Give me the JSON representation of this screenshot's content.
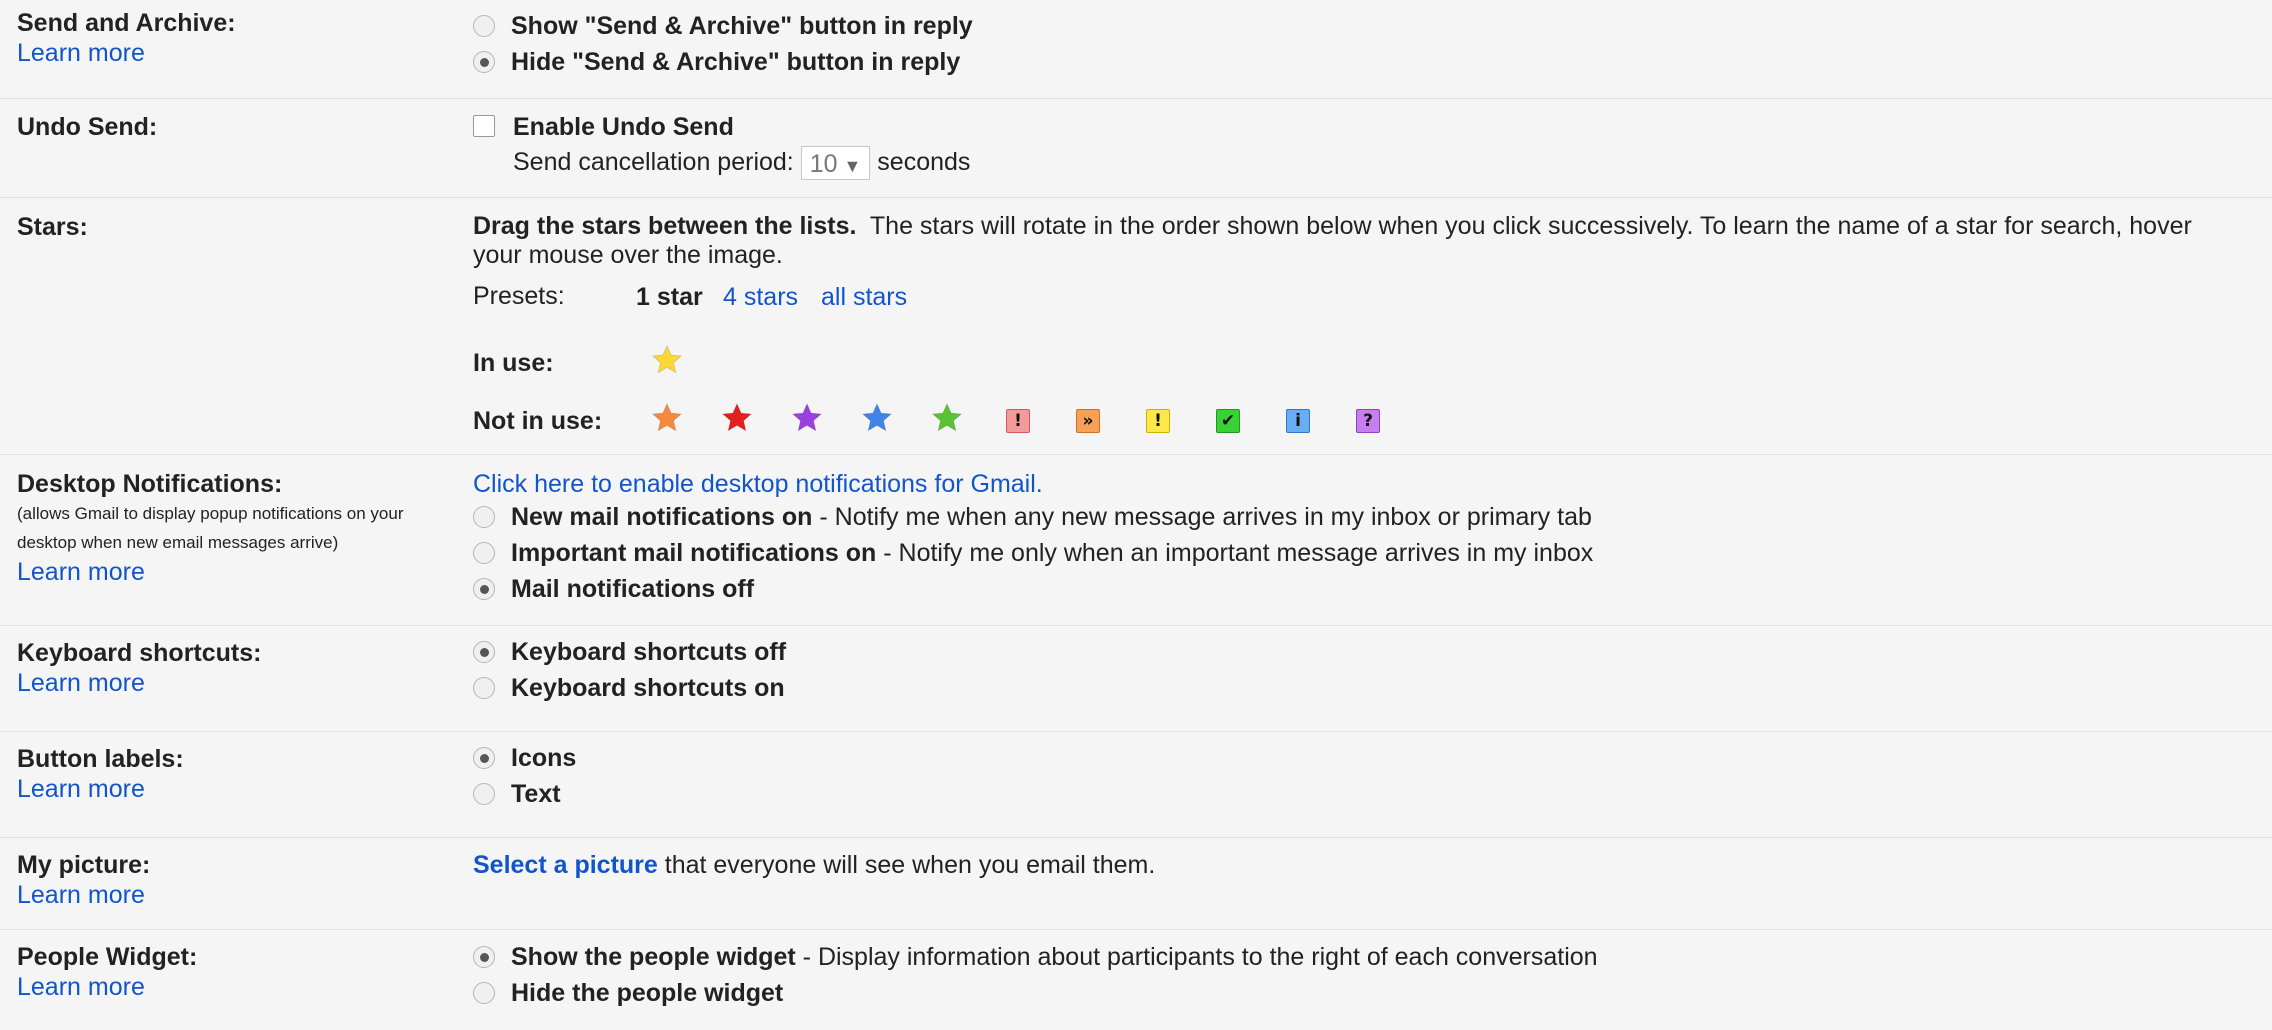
{
  "send_archive": {
    "title": "Send and Archive:",
    "learn_more": "Learn more",
    "options": [
      {
        "label": "Show \"Send & Archive\" button in reply",
        "selected": false
      },
      {
        "label": "Hide \"Send & Archive\" button in reply",
        "selected": true
      }
    ]
  },
  "undo_send": {
    "title": "Undo Send:",
    "checkbox_label": "Enable Undo Send",
    "checked": false,
    "period_label": "Send cancellation period:",
    "period_value": "10",
    "period_unit": "seconds"
  },
  "stars": {
    "title": "Stars:",
    "instruction_bold": "Drag the stars between the lists.",
    "instruction": "The stars will rotate in the order shown below when you click successively. To learn the name of a star for search, hover your mouse over the image.",
    "presets_label": "Presets:",
    "preset_selected": "1 star",
    "preset_links": [
      "4 stars",
      "all stars"
    ],
    "in_use_label": "In use:",
    "in_use": [
      {
        "icon": "yellow-star-icon",
        "color": "#fdd835"
      }
    ],
    "not_in_use_label": "Not in use:",
    "not_in_use": [
      {
        "icon": "orange-star-icon",
        "color": "#f6893b"
      },
      {
        "icon": "red-star-icon",
        "color": "#e41f1f"
      },
      {
        "icon": "purple-star-icon",
        "color": "#9c3fe0"
      },
      {
        "icon": "blue-star-icon",
        "color": "#3f85e8"
      },
      {
        "icon": "green-star-icon",
        "color": "#5bc236"
      },
      {
        "icon": "red-bang-icon",
        "glyph": "!",
        "color": "#f29b9b",
        "border": "#d25a5a"
      },
      {
        "icon": "orange-guillemet-icon",
        "glyph": "»",
        "color": "#f6a157",
        "border": "#d07020"
      },
      {
        "icon": "yellow-bang-icon",
        "glyph": "!",
        "color": "#fbe94a",
        "border": "#c9b300"
      },
      {
        "icon": "green-check-icon",
        "glyph": "✔",
        "color": "#39d133",
        "border": "#1e9a1a"
      },
      {
        "icon": "blue-info-icon",
        "glyph": "i",
        "color": "#68aef4",
        "border": "#2f78c4"
      },
      {
        "icon": "purple-question-icon",
        "glyph": "?",
        "color": "#c77ff0",
        "border": "#9040c0"
      }
    ]
  },
  "desktop_notifications": {
    "title": "Desktop Notifications:",
    "desc_line1": "(allows Gmail to display popup notifications on your",
    "desc_line2": "desktop when new email messages arrive)",
    "learn_more": "Learn more",
    "enable_link": "Click here to enable desktop notifications for Gmail.",
    "options": [
      {
        "bold": "New mail notifications on",
        "rest": " - Notify me when any new message arrives in my inbox or primary tab",
        "selected": false
      },
      {
        "bold": "Important mail notifications on",
        "rest": " - Notify me only when an important message arrives in my inbox",
        "selected": false
      },
      {
        "bold": "Mail notifications off",
        "rest": "",
        "selected": true
      }
    ]
  },
  "keyboard_shortcuts": {
    "title": "Keyboard shortcuts:",
    "learn_more": "Learn more",
    "options": [
      {
        "label": "Keyboard shortcuts off",
        "selected": true
      },
      {
        "label": "Keyboard shortcuts on",
        "selected": false
      }
    ]
  },
  "button_labels": {
    "title": "Button labels:",
    "learn_more": "Learn more",
    "options": [
      {
        "label": "Icons",
        "selected": true
      },
      {
        "label": "Text",
        "selected": false
      }
    ]
  },
  "my_picture": {
    "title": "My picture:",
    "learn_more": "Learn more",
    "link": "Select a picture",
    "rest": " that everyone will see when you email them."
  },
  "people_widget": {
    "title": "People Widget:",
    "learn_more": "Learn more",
    "options": [
      {
        "bold": "Show the people widget",
        "rest": " - Display information about participants to the right of each conversation",
        "selected": true
      },
      {
        "bold": "Hide the people widget",
        "rest": "",
        "selected": false
      }
    ]
  }
}
